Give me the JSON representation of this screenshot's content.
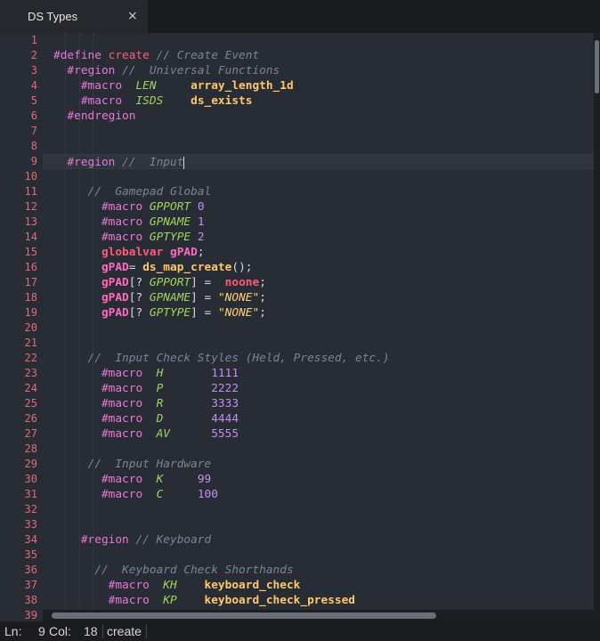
{
  "tab": {
    "title": "DS Types",
    "close_glyph": "×"
  },
  "status": {
    "ln_label": "Ln:",
    "ln": "9",
    "col_label": "Col:",
    "col": "18",
    "mode": "create"
  },
  "lines": [
    [],
    [
      [
        "define",
        "#define "
      ],
      [
        "name",
        "create "
      ],
      [
        "comment",
        "// Create Event"
      ]
    ],
    [
      [
        "text",
        "  "
      ],
      [
        "directive",
        "#region "
      ],
      [
        "comment",
        "//  Universal Functions"
      ]
    ],
    [
      [
        "text",
        "    "
      ],
      [
        "directive",
        "#macro  "
      ],
      [
        "const",
        "LEN     "
      ],
      [
        "func",
        "array_length_1d"
      ]
    ],
    [
      [
        "text",
        "    "
      ],
      [
        "directive",
        "#macro  "
      ],
      [
        "const",
        "ISDS    "
      ],
      [
        "func",
        "ds_exists"
      ]
    ],
    [
      [
        "text",
        "  "
      ],
      [
        "directive",
        "#endregion"
      ]
    ],
    [],
    [],
    [
      [
        "text",
        "  "
      ],
      [
        "directive",
        "#region "
      ],
      [
        "comment",
        "//  Input"
      ]
    ],
    [],
    [
      [
        "text",
        "     "
      ],
      [
        "comment",
        "//  Gamepad Global"
      ]
    ],
    [
      [
        "text",
        "       "
      ],
      [
        "directive",
        "#macro "
      ],
      [
        "const",
        "GPPORT "
      ],
      [
        "num",
        "0"
      ]
    ],
    [
      [
        "text",
        "       "
      ],
      [
        "directive",
        "#macro "
      ],
      [
        "const",
        "GPNAME "
      ],
      [
        "num",
        "1"
      ]
    ],
    [
      [
        "text",
        "       "
      ],
      [
        "directive",
        "#macro "
      ],
      [
        "const",
        "GPTYPE "
      ],
      [
        "num",
        "2"
      ]
    ],
    [
      [
        "text",
        "       "
      ],
      [
        "kw",
        "globalvar "
      ],
      [
        "var",
        "gPAD"
      ],
      [
        "text",
        ";"
      ]
    ],
    [
      [
        "text",
        "       "
      ],
      [
        "var",
        "gPAD"
      ],
      [
        "text",
        "= "
      ],
      [
        "func",
        "ds_map_create"
      ],
      [
        "text",
        "();"
      ]
    ],
    [
      [
        "text",
        "       "
      ],
      [
        "var",
        "gPAD"
      ],
      [
        "text",
        "[? "
      ],
      [
        "const",
        "GPPORT"
      ],
      [
        "text",
        "] =  "
      ],
      [
        "kw",
        "noone"
      ],
      [
        "text",
        ";"
      ]
    ],
    [
      [
        "text",
        "       "
      ],
      [
        "var",
        "gPAD"
      ],
      [
        "text",
        "[? "
      ],
      [
        "const",
        "GPNAME"
      ],
      [
        "text",
        "] = "
      ],
      [
        "str",
        "\"NONE\""
      ],
      [
        "text",
        ";"
      ]
    ],
    [
      [
        "text",
        "       "
      ],
      [
        "var",
        "gPAD"
      ],
      [
        "text",
        "[? "
      ],
      [
        "const",
        "GPTYPE"
      ],
      [
        "text",
        "] = "
      ],
      [
        "str",
        "\"NONE\""
      ],
      [
        "text",
        ";"
      ]
    ],
    [],
    [],
    [
      [
        "text",
        "     "
      ],
      [
        "comment",
        "//  Input Check Styles (Held, Pressed, etc.)"
      ]
    ],
    [
      [
        "text",
        "       "
      ],
      [
        "directive",
        "#macro  "
      ],
      [
        "const",
        "H       "
      ],
      [
        "num",
        "1111"
      ]
    ],
    [
      [
        "text",
        "       "
      ],
      [
        "directive",
        "#macro  "
      ],
      [
        "const",
        "P       "
      ],
      [
        "num",
        "2222"
      ]
    ],
    [
      [
        "text",
        "       "
      ],
      [
        "directive",
        "#macro  "
      ],
      [
        "const",
        "R       "
      ],
      [
        "num",
        "3333"
      ]
    ],
    [
      [
        "text",
        "       "
      ],
      [
        "directive",
        "#macro  "
      ],
      [
        "const",
        "D       "
      ],
      [
        "num",
        "4444"
      ]
    ],
    [
      [
        "text",
        "       "
      ],
      [
        "directive",
        "#macro  "
      ],
      [
        "const",
        "AV      "
      ],
      [
        "num",
        "5555"
      ]
    ],
    [],
    [
      [
        "text",
        "     "
      ],
      [
        "comment",
        "//  Input Hardware"
      ]
    ],
    [
      [
        "text",
        "       "
      ],
      [
        "directive",
        "#macro  "
      ],
      [
        "const",
        "K     "
      ],
      [
        "num",
        "99"
      ]
    ],
    [
      [
        "text",
        "       "
      ],
      [
        "directive",
        "#macro  "
      ],
      [
        "const",
        "C     "
      ],
      [
        "num",
        "100"
      ]
    ],
    [],
    [],
    [
      [
        "text",
        "    "
      ],
      [
        "directive",
        "#region "
      ],
      [
        "comment",
        "// Keyboard"
      ]
    ],
    [],
    [
      [
        "text",
        "      "
      ],
      [
        "comment",
        "//  Keyboard Check Shorthands"
      ]
    ],
    [
      [
        "text",
        "        "
      ],
      [
        "directive",
        "#macro  "
      ],
      [
        "const",
        "KH    "
      ],
      [
        "func",
        "keyboard_check"
      ]
    ],
    [
      [
        "text",
        "        "
      ],
      [
        "directive",
        "#macro  "
      ],
      [
        "const",
        "KP    "
      ],
      [
        "func",
        "keyboard_check_pressed"
      ]
    ],
    []
  ]
}
